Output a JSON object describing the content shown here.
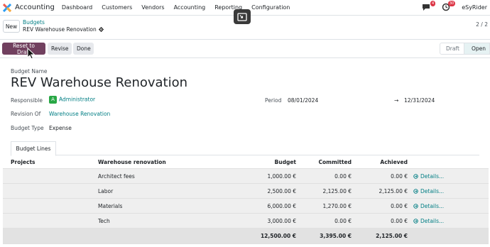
{
  "nav": {
    "app_name": "Accounting",
    "menu": [
      "Dashboard",
      "Customers",
      "Vendors",
      "Accounting",
      "Reporting",
      "Configuration"
    ],
    "messages_badge": "4",
    "activities_badge": "30",
    "user": "eSyRider"
  },
  "control_panel": {
    "new_button": "New",
    "breadcrumb_parent": "Budgets",
    "breadcrumb_current": "REV Warehouse Renovation",
    "pager": "2 / 2"
  },
  "statusbar": {
    "buttons": [
      "Reset to Draft",
      "Revise",
      "Done"
    ],
    "stages": [
      "Draft",
      "Open"
    ],
    "active_stage": "Open"
  },
  "form": {
    "name_label": "Budget Name",
    "name": "REV Warehouse Renovation",
    "responsible_label": "Responsible",
    "responsible_initial": "A",
    "responsible": "Administrator",
    "period_label": "Period",
    "period_start": "08/01/2024",
    "period_arrow": "→",
    "period_end": "12/31/2024",
    "revision_label": "Revision Of",
    "revision": "Warehouse Renovation",
    "type_label": "Budget Type",
    "type": "Expense"
  },
  "tab_label": "Budget Lines",
  "table": {
    "columns": [
      "Projects",
      "Warehouse renovation",
      "Budget",
      "Committed",
      "Achieved"
    ],
    "rows": [
      {
        "project": "",
        "name": "Architect fees",
        "budget": "1,000.00 €",
        "committed": "0.00 €",
        "achieved": "0.00 €",
        "details": "Details..."
      },
      {
        "project": "",
        "name": "Labor",
        "budget": "2,500.00 €",
        "committed": "2,125.00 €",
        "achieved": "2,125.00 €",
        "details": "Details..."
      },
      {
        "project": "",
        "name": "Materials",
        "budget": "6,000.00 €",
        "committed": "1,270.00 €",
        "achieved": "0.00 €",
        "details": "Details..."
      },
      {
        "project": "",
        "name": "Tech",
        "budget": "3,000.00 €",
        "committed": "0.00 €",
        "achieved": "0.00 €",
        "details": "Details..."
      }
    ],
    "totals": {
      "budget": "12,500.00 €",
      "committed": "3,395.00 €",
      "achieved": "2,125.00 €"
    }
  },
  "colors": {
    "primary": "#71405f",
    "link": "#017e84",
    "avatar": "#28a745",
    "badge": "#dc3545"
  }
}
